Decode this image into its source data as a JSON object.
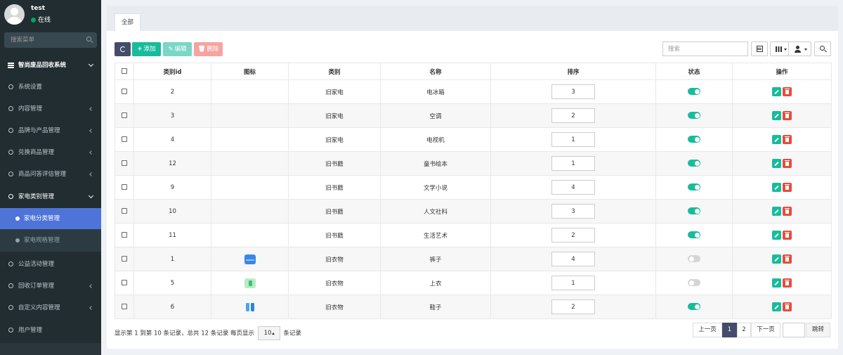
{
  "user": {
    "name": "test",
    "status": "在线"
  },
  "sidebar": {
    "search_placeholder": "搜索菜单",
    "header": "智尚废品回收系统",
    "items": [
      {
        "label": "系统设置",
        "has_children": false
      },
      {
        "label": "内容管理",
        "has_children": true
      },
      {
        "label": "品牌与产品管理",
        "has_children": true
      },
      {
        "label": "兑换商品管理",
        "has_children": true
      },
      {
        "label": "商品问答评估管理",
        "has_children": true
      },
      {
        "label": "家电类别管理",
        "has_children": true,
        "open": true
      },
      {
        "label": "公益活动管理",
        "has_children": false
      },
      {
        "label": "回收订单管理",
        "has_children": true
      },
      {
        "label": "自定义内容管理",
        "has_children": true
      },
      {
        "label": "用户管理",
        "has_children": false
      }
    ],
    "sub_items": [
      {
        "label": "家电分类管理",
        "active": true
      },
      {
        "label": "家电规格管理",
        "active": false
      }
    ]
  },
  "tabs": [
    {
      "label": "全部"
    }
  ],
  "toolbar": {
    "add_label": "添加",
    "edit_label": "编辑",
    "delete_label": "删除",
    "search_placeholder": "搜索"
  },
  "table": {
    "headers": [
      "类别id",
      "图标",
      "类别",
      "名称",
      "排序",
      "状态",
      "操作"
    ],
    "rows": [
      {
        "id": "2",
        "icon": "",
        "category": "旧家电",
        "name": "电冰箱",
        "sort": "3",
        "status": true
      },
      {
        "id": "3",
        "icon": "",
        "category": "旧家电",
        "name": "空调",
        "sort": "2",
        "status": true
      },
      {
        "id": "4",
        "icon": "",
        "category": "旧家电",
        "name": "电视机",
        "sort": "1",
        "status": true
      },
      {
        "id": "12",
        "icon": "",
        "category": "旧书籍",
        "name": "童书绘本",
        "sort": "1",
        "status": true
      },
      {
        "id": "9",
        "icon": "",
        "category": "旧书籍",
        "name": "文学小说",
        "sort": "4",
        "status": true
      },
      {
        "id": "10",
        "icon": "",
        "category": "旧书籍",
        "name": "人文社科",
        "sort": "3",
        "status": true
      },
      {
        "id": "11",
        "icon": "",
        "category": "旧书籍",
        "name": "生活艺术",
        "sort": "2",
        "status": true
      },
      {
        "id": "1",
        "icon": "pants-icon",
        "category": "旧衣物",
        "name": "裤子",
        "sort": "4",
        "status": false
      },
      {
        "id": "5",
        "icon": "shirt-icon",
        "category": "旧衣物",
        "name": "上衣",
        "sort": "1",
        "status": false
      },
      {
        "id": "6",
        "icon": "shoes-icon",
        "category": "旧衣物",
        "name": "鞋子",
        "sort": "2",
        "status": true
      }
    ]
  },
  "footer": {
    "summary_prefix": "显示第 1 到第 10 条记录，总共 12 条记录 每页显示",
    "page_size": "10",
    "summary_suffix": "条记录",
    "prev_label": "上一页",
    "next_label": "下一页",
    "pages": [
      "1",
      "2"
    ],
    "current_page": "1",
    "jump_label": "跳转"
  },
  "colors": {
    "sidebar_bg": "#222d32",
    "active_menu": "#4e74da",
    "primary": "#18bc9c",
    "danger": "#e74c3c",
    "dark_button": "#444c69"
  }
}
